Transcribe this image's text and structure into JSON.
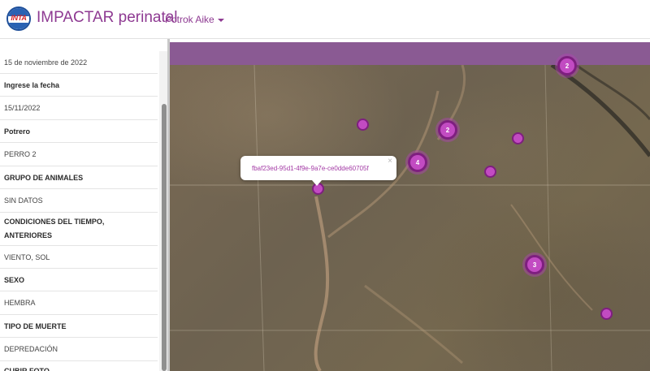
{
  "header": {
    "logo_text": "INTA",
    "title": "IMPACTAR perinatal",
    "site": "Potrok Aike"
  },
  "panel": {
    "rows": [
      {
        "text": "15 de noviembre de 2022",
        "kind": "val"
      },
      {
        "text": "Ingrese la fecha",
        "kind": "label"
      },
      {
        "text": "15/11/2022",
        "kind": "val"
      },
      {
        "text": "Potrero",
        "kind": "label"
      },
      {
        "text": "PERRO 2",
        "kind": "val"
      },
      {
        "text": "GRUPO DE ANIMALES",
        "kind": "label"
      },
      {
        "text": "SIN DATOS",
        "kind": "val"
      },
      {
        "text": "CONDICIONES DEL TIEMPO, ANTERIORES",
        "kind": "label"
      },
      {
        "text": "VIENTO, SOL",
        "kind": "val"
      },
      {
        "text": "SEXO",
        "kind": "label"
      },
      {
        "text": "HEMBRA",
        "kind": "val"
      },
      {
        "text": "TIPO DE MUERTE",
        "kind": "label"
      },
      {
        "text": "DEPREDACIÓN",
        "kind": "val"
      },
      {
        "text": "CUBIR FOTO",
        "kind": "label"
      }
    ]
  },
  "map": {
    "popup_text": "fbaf23ed-95d1-4f9e-9a7e-ce0dde60705f",
    "popup_close": "×",
    "clusters": [
      {
        "count": "2"
      },
      {
        "count": "2"
      },
      {
        "count": "4"
      },
      {
        "count": "3"
      }
    ],
    "marker_color": "#c24bc2"
  }
}
